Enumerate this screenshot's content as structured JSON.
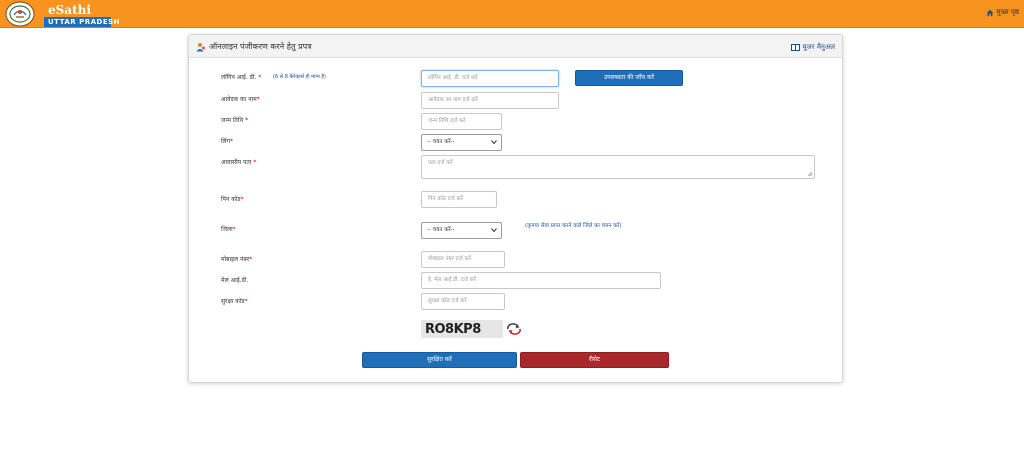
{
  "header": {
    "brand_name": "eSathi",
    "state": "UTTAR PRADESH",
    "home_link": "मुख्य पृष्ठ"
  },
  "panel": {
    "title": "ऑनलाइन पंजीकरण करने हेतु प्रपत्र",
    "manual_link": "यूजर मैनुअल"
  },
  "form": {
    "login_id": {
      "label": "लॉगिन आई. डी.",
      "required": "*",
      "hint": "(6 से 8 कैरेक्टर्स ही मान्य है)",
      "placeholder": "लॉगिन आई. डी. दर्ज करें"
    },
    "check_button": "उपलब्धता की जाँच करें",
    "applicant_name": {
      "label": "आवेदक का नाम",
      "required": "*",
      "placeholder": "आवेदक का नाम दर्ज करें"
    },
    "dob": {
      "label": "जन्म तिथि",
      "required": "*",
      "placeholder": "जन्म तिथि दर्ज करें"
    },
    "gender": {
      "label": "लिंग",
      "required": "*",
      "selected": "-- चयन करें--"
    },
    "address": {
      "label": "आवासीय पता",
      "required": "*",
      "placeholder": "पता दर्ज करें"
    },
    "pin": {
      "label": "पिन कोड",
      "required": "*",
      "placeholder": "पिन कोड दर्ज करें"
    },
    "district": {
      "label": "जिला",
      "required": "*",
      "selected": "-- चयन करें--",
      "hint": "(कृपया सेवा प्राप्त करने वाले जिले का चयन करें)"
    },
    "mobile": {
      "label": "मोबाइल नंबर",
      "required": "*",
      "placeholder": "मोबाइल नंबर दर्ज करें"
    },
    "email": {
      "label": "मेल आई.डी.",
      "placeholder": "ई. मेल आई.डी. दर्ज करें"
    },
    "security_code": {
      "label": "सुरक्षा कोड",
      "required": "*",
      "placeholder": "सुरक्षा कोड दर्ज करें"
    },
    "captcha_text": "RO8KP8",
    "submit_button": "सुरक्षित करें",
    "reset_button": "रीसेट"
  },
  "colors": {
    "header_bg": "#f7931e",
    "primary_button": "#1f6fb8",
    "reset_button": "#a8282b"
  },
  "icons": {
    "logo": "up-emblem-icon",
    "home": "home-icon",
    "user": "user-icon",
    "manual": "book-icon",
    "refresh": "refresh-icon"
  }
}
